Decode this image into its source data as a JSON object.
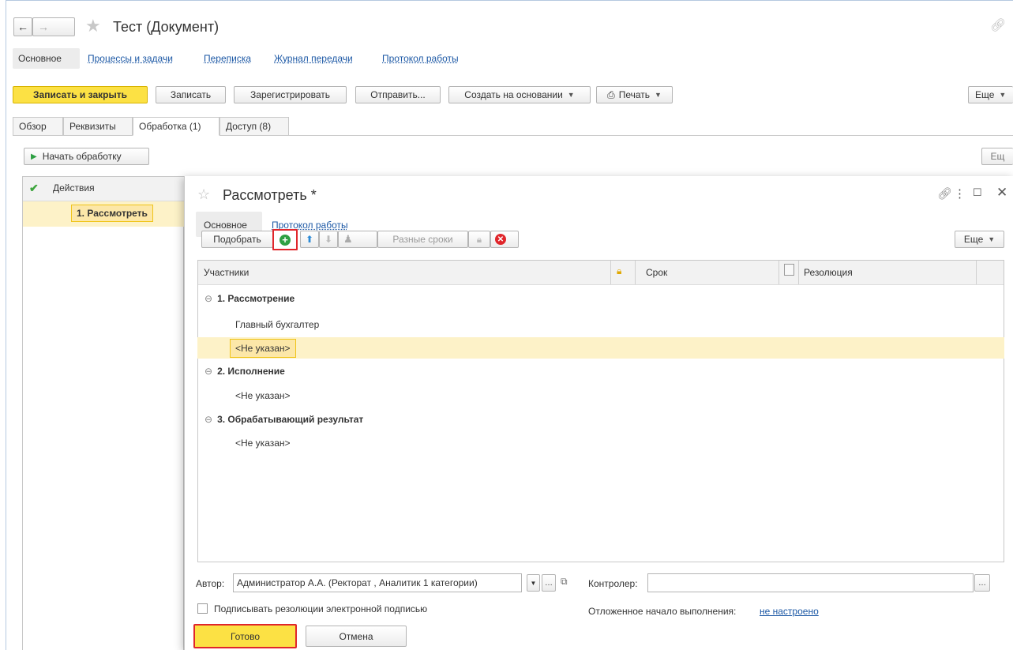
{
  "window": {
    "title": "Тест (Документ)"
  },
  "nav_tabs": [
    "Основное",
    "Процессы и задачи",
    "Переписка",
    "Журнал передачи",
    "Протокол работы"
  ],
  "toolbar": {
    "save_close": "Записать и закрыть",
    "save": "Записать",
    "register": "Зарегистрировать",
    "send": "Отправить...",
    "create_based": "Создать на основании",
    "print": "Печать",
    "more": "Еще"
  },
  "doc_tabs": [
    "Обзор",
    "Реквизиты",
    "Обработка (1)",
    "Доступ (8)"
  ],
  "left_panel": {
    "start_button": "Начать обработку",
    "column_header": "Действия",
    "row_item": "1. Рассмотреть",
    "more_clipped": "Ещ"
  },
  "dialog": {
    "title": "Рассмотреть *",
    "tabs": [
      "Основное",
      "Протокол работы"
    ],
    "toolbar": {
      "pick": "Подобрать",
      "diff_terms": "Разные сроки",
      "more": "Еще"
    },
    "table": {
      "columns": [
        "Участники",
        "Срок",
        "Резолюция"
      ],
      "groups": [
        {
          "title": "1. Рассмотрение",
          "items": [
            "Главный бухгалтер",
            "<Не указан>"
          ]
        },
        {
          "title": "2. Исполнение",
          "items": [
            "<Не указан>"
          ]
        },
        {
          "title": "3. Обрабатывающий результат",
          "items": [
            "<Не указан>"
          ]
        }
      ]
    },
    "author_label": "Автор:",
    "author_value": "Администратор А.А. (Ректорат , Аналитик 1 категории)",
    "controller_label": "Контролер:",
    "controller_value": "",
    "sign_checkbox": "Подписывать резолюции электронной подписью",
    "sign_checked": false,
    "deferred_label": "Отложенное начало выполнения:",
    "deferred_link": "не настроено",
    "done": "Готово",
    "cancel": "Отмена"
  },
  "colors": {
    "accent_yellow": "#fce144",
    "link_blue": "#1c58a5",
    "highlight_red": "#e0262b",
    "selection": "#fdf2c8"
  }
}
